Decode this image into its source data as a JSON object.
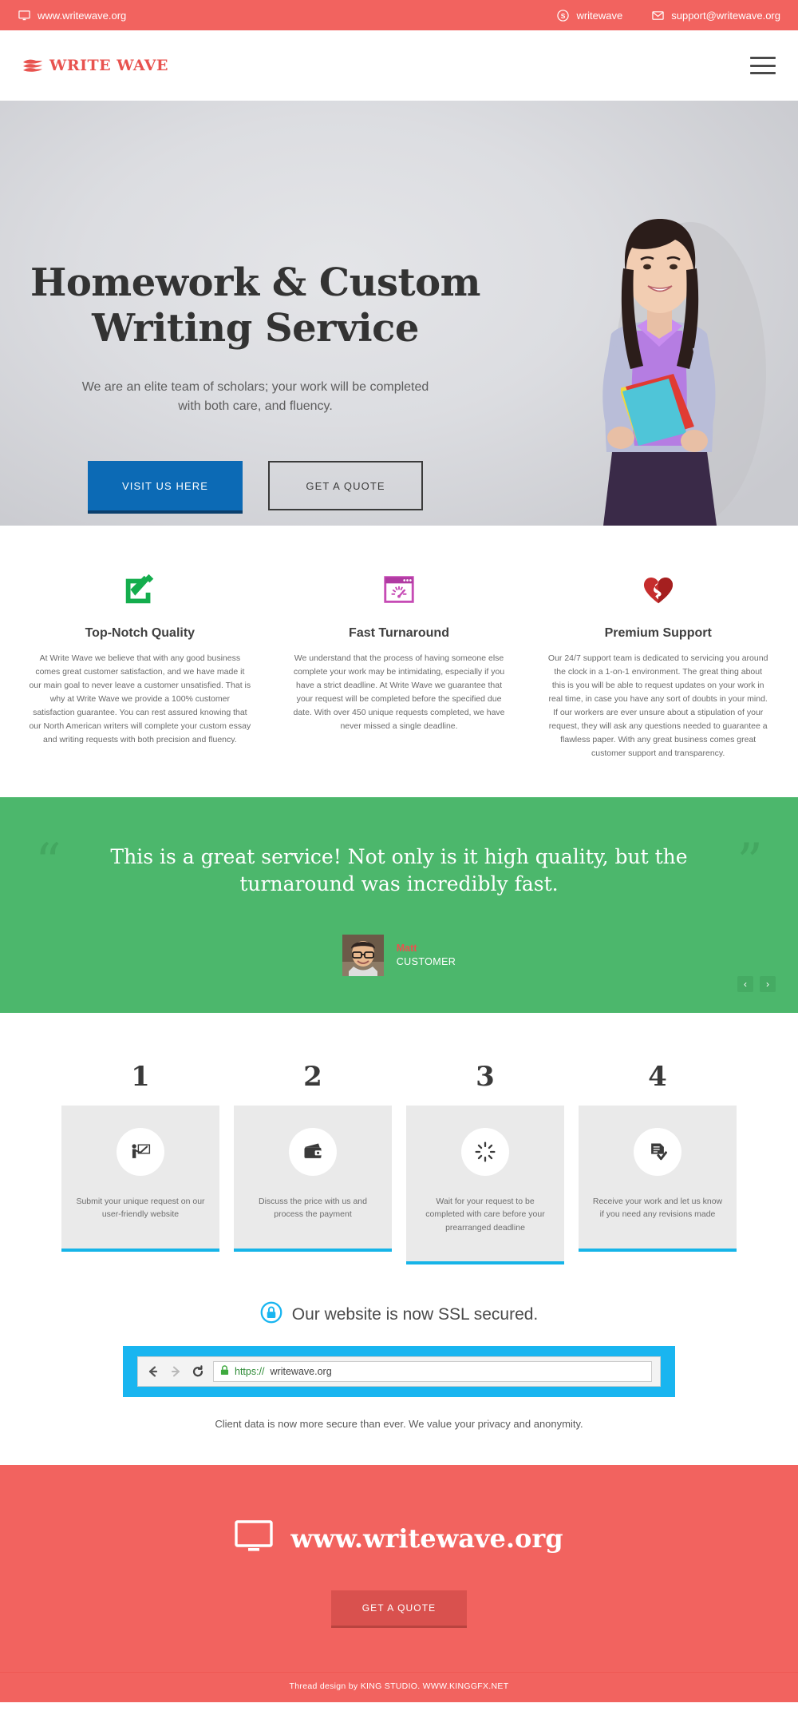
{
  "topbar": {
    "site": "www.writewave.org",
    "site_icon": "monitor-icon",
    "skype_label": "writewave",
    "skype_icon": "skype-icon",
    "email": "support@writewave.org",
    "email_icon": "envelope-icon",
    "bg_color": "#f2635f"
  },
  "header": {
    "logo_text": "WRITE WAVE",
    "logo_icon": "stacked-waves-icon",
    "logo_color": "#e8534f",
    "menu_icon": "hamburger-icon"
  },
  "hero": {
    "title_line1": "Homework & Custom",
    "title_line2": "Writing Service",
    "subtitle": "We are an elite team of scholars; your work will be completed with both care, and fluency.",
    "primary_button": "VISIT US HERE",
    "primary_color": "#0c6ab5",
    "secondary_button": "GET A QUOTE",
    "person_image": "smiling-student-holding-books-photo"
  },
  "features": [
    {
      "icon": "pencil-checkbox-icon",
      "icon_color": "#14ad4d",
      "title": "Top-Notch Quality",
      "body": "At Write Wave we believe that with any good business comes great customer satisfaction, and we have made it our main goal to never leave a customer unsatisfied. That is why at Write Wave we provide a 100% customer satisfaction guarantee. You can rest assured knowing that our North American writers will complete your custom essay and writing requests with both precision and fluency."
    },
    {
      "icon": "browser-speedometer-icon",
      "icon_color": "#c64bb5",
      "title": "Fast Turnaround",
      "body": "We understand that the process of having someone else complete your work may be intimidating, especially if you have a strict deadline. At Write Wave we guarantee that your request will be completed before the specified due date. With over 450 unique requests completed, we have never missed a single deadline."
    },
    {
      "icon": "heart-ribbon-icon",
      "icon_color": "#c62d2d",
      "title": "Premium Support",
      "body": "Our 24/7 support team is dedicated to servicing you around the clock in a 1-on-1 environment. The great thing about this is you will be able to request updates on your work in real time, in case you have any sort of doubts in your mind. If our workers are ever unsure about a stipulation of your request, they will ask any questions needed to guarantee a flawless paper. With any great business comes great customer support and transparency."
    }
  ],
  "testimonial": {
    "bg_color": "#4cb76c",
    "open_quote": "“",
    "close_quote": "”",
    "text": "This is a great service! Not only is it high quality, but the turnaround was incredibly fast.",
    "author_name": "Matt",
    "author_role": "CUSTOMER",
    "author_name_color": "#e8534f",
    "avatar": "matt-headshot-photo",
    "prev_label": "‹",
    "next_label": "›"
  },
  "steps": [
    {
      "number": "1",
      "icon": "presenter-board-icon",
      "text": "Submit your unique request on our user-friendly website"
    },
    {
      "number": "2",
      "icon": "wallet-icon",
      "text": "Discuss the price with us and process the payment"
    },
    {
      "number": "3",
      "icon": "loading-spinner-icon",
      "text": "Wait for your request to be completed with care before your prearranged deadline"
    },
    {
      "number": "4",
      "icon": "document-check-icon",
      "text": "Receive your work and let us know if you need any revisions made"
    }
  ],
  "steps_accent_color": "#16b4e8",
  "ssl": {
    "lock_icon": "lock-circle-icon",
    "heading": "Our website is now SSL secured.",
    "bar_color": "#19b5f0",
    "back_icon": "arrow-left-icon",
    "forward_icon": "arrow-right-icon",
    "reload_icon": "reload-icon",
    "padlock_icon": "padlock-icon",
    "url_scheme": "https://",
    "url_rest": "writewave.org",
    "footnote": "Client data is now more secure than ever. We value your privacy and anonymity."
  },
  "footer": {
    "bg_color": "#f2635f",
    "monitor_icon": "monitor-icon",
    "url": "www.writewave.org",
    "button": "GET A QUOTE",
    "credit": "Thread design by KING STUDIO. WWW.KINGGFX.NET"
  }
}
